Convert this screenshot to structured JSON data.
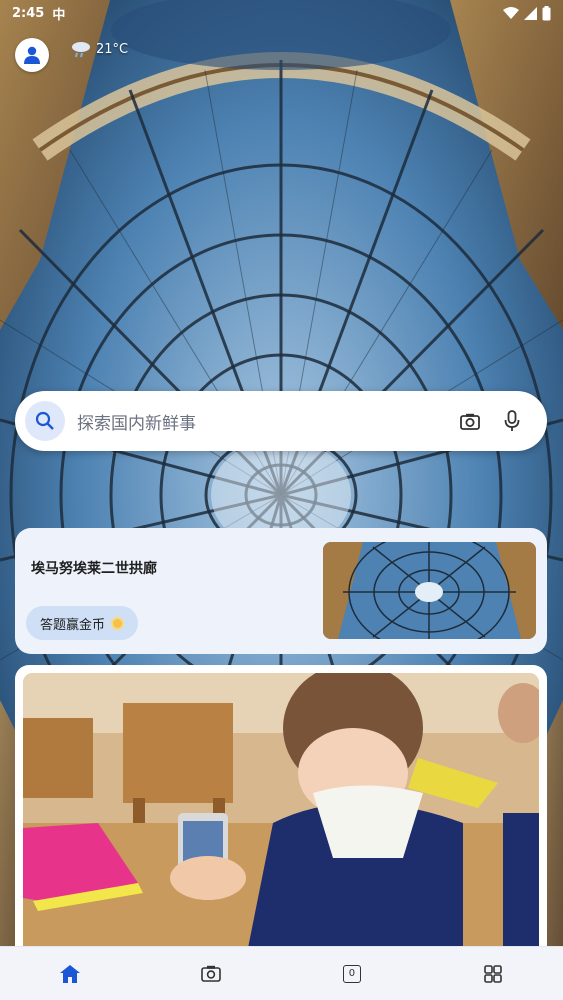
{
  "status_bar": {
    "time": "2:45",
    "carrier": "中"
  },
  "weather": {
    "text": "21°C",
    "icon": "cloud-rain-icon"
  },
  "search": {
    "placeholder": "探索国内新鲜事"
  },
  "feature_card": {
    "title": "埃马努埃莱二世拱廊",
    "action_label": "答题赢金币"
  },
  "colors": {
    "accent": "#1a56d6",
    "card_bg": "#eef3fb",
    "pill_bg": "#cfdff5",
    "nav_bg": "#f2f4fa"
  },
  "nav": {
    "items": [
      "home-icon",
      "camera-icon",
      "tabs-icon",
      "apps-icon"
    ],
    "tabs_count": "0"
  }
}
